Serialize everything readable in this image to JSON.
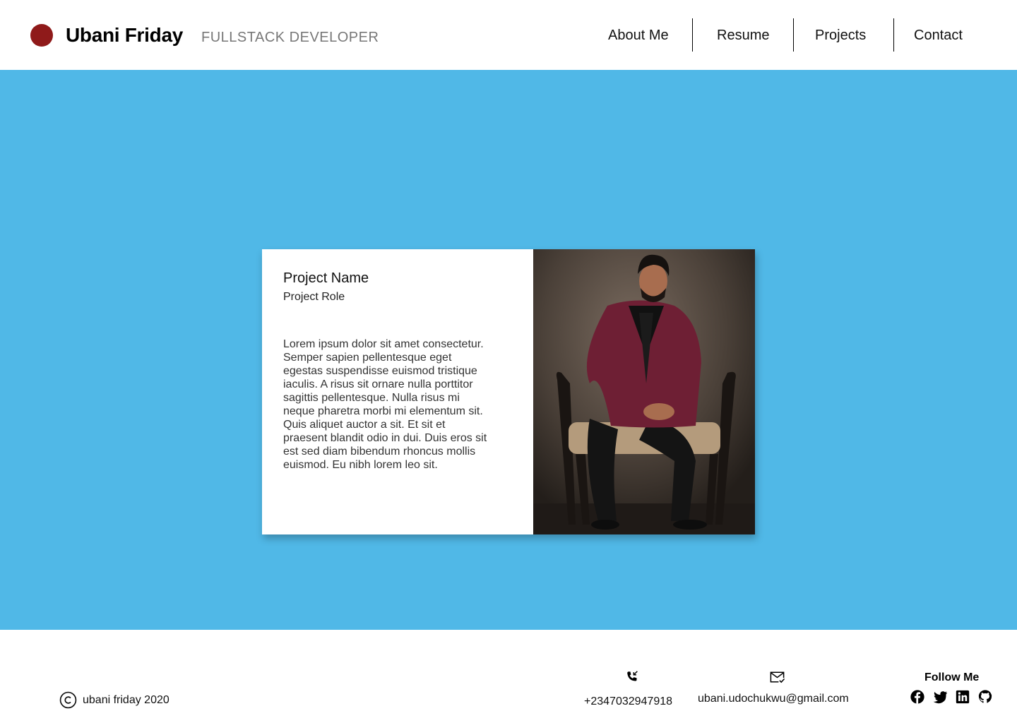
{
  "header": {
    "name": "Ubani Friday",
    "role": "FULLSTACK DEVELOPER",
    "logo_color": "#8f1a1a",
    "nav": [
      "About Me",
      "Resume",
      "Projects",
      "Contact"
    ]
  },
  "hero": {
    "background": "#50b8e7",
    "card": {
      "title": "Project Name",
      "role": "Project Role",
      "description": "Lorem ipsum dolor sit amet consectetur. Semper sapien pellentesque eget egestas suspendisse euismod tristique iaculis. A risus sit ornare nulla porttitor sagittis pellentesque. Nulla risus mi neque pharetra morbi mi elementum sit. Quis aliquet auctor a sit. Et sit et praesent blandit odio in dui. Duis eros sit est sed diam bibendum rhoncus mollis euismod. Eu nibh lorem leo sit."
    }
  },
  "footer": {
    "copyright": "ubani friday 2020",
    "phone": "+2347032947918",
    "email": "ubani.udochukwu@gmail.com",
    "follow_title": "Follow Me",
    "socials": [
      "facebook-icon",
      "twitter-icon",
      "linkedin-icon",
      "github-icon"
    ]
  }
}
